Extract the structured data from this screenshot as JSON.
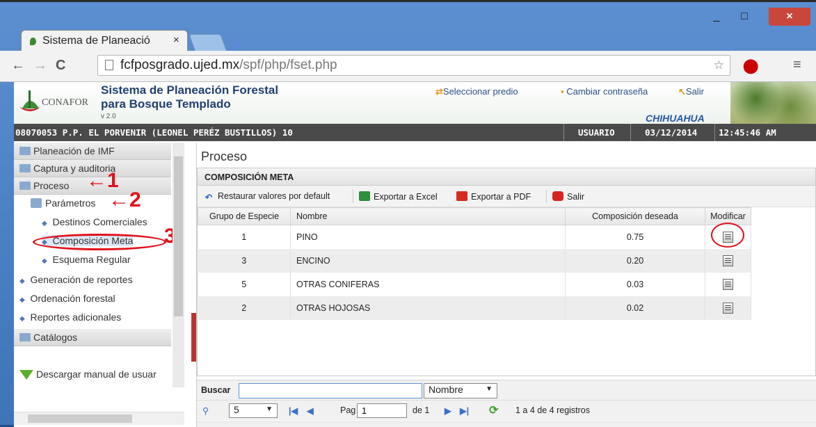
{
  "browser": {
    "tab_title": "Sistema de Planeació",
    "tab_close": "×",
    "window_min": "_",
    "window_max": "□",
    "window_close": "×",
    "url_host": "fcfposgrado.ujed.mx",
    "url_path": "/spf/php/fset.php"
  },
  "header": {
    "logo_text": "CONAFOR",
    "title_line1": "Sistema de Planeación Forestal",
    "title_line2": "para Bosque Templado",
    "version": "v 2.0",
    "link_select": "Seleccionar predio",
    "link_password": "Cambiar contraseña",
    "link_exit": "Salir",
    "state": "CHIHUAHUA"
  },
  "infobar": {
    "predio": "08070053 P.P. EL PORVENIR (LEONEL PERÉZ BUSTILLOS) 10",
    "user": "USUARIO",
    "date": "03/12/2014",
    "time": "12:45:46 AM"
  },
  "sidebar": {
    "planeacion": "Planeación de IMF",
    "captura": "Captura y auditoria",
    "proceso": "Proceso",
    "parametros": "Parámetros",
    "destinos": "Destinos Comerciales",
    "composicion": "Composición Meta",
    "esquema": "Esquema Regular",
    "generacion": "Generación de reportes",
    "ordenacion": "Ordenación forestal",
    "reportes": "Reportes adicionales",
    "catalogos": "Catálogos",
    "manual": "Descargar manual de usuar"
  },
  "annotations": {
    "n1": "1",
    "n2": "2",
    "n3": "3"
  },
  "main": {
    "page_title": "Proceso",
    "panel_title": "COMPOSICIÓN META",
    "toolbar": {
      "restore": "Restaurar valores por default",
      "excel": "Exportar a Excel",
      "pdf": "Exportar a PDF",
      "exit": "Salir"
    },
    "columns": [
      "Grupo de Especie",
      "Nombre",
      "Composición deseada",
      "Modificar"
    ],
    "rows": [
      {
        "grupo": "1",
        "nombre": "PINO",
        "comp": "0.75"
      },
      {
        "grupo": "3",
        "nombre": "ENCINO",
        "comp": "0.20"
      },
      {
        "grupo": "5",
        "nombre": "OTRAS CONIFERAS",
        "comp": "0.03"
      },
      {
        "grupo": "2",
        "nombre": "OTRAS HOJOSAS",
        "comp": "0.02"
      }
    ],
    "footer": {
      "search_label": "Buscar",
      "search_value": "",
      "search_field": "Nombre",
      "page_size": "5",
      "pag_label": "Pag",
      "page_value": "1",
      "of_label": "de 1",
      "records": "1 a 4 de 4 registros"
    }
  },
  "colors": {
    "header_bar": "#4a4a4a",
    "title_blue": "#213f72",
    "annotation_red": "#e0101a"
  }
}
